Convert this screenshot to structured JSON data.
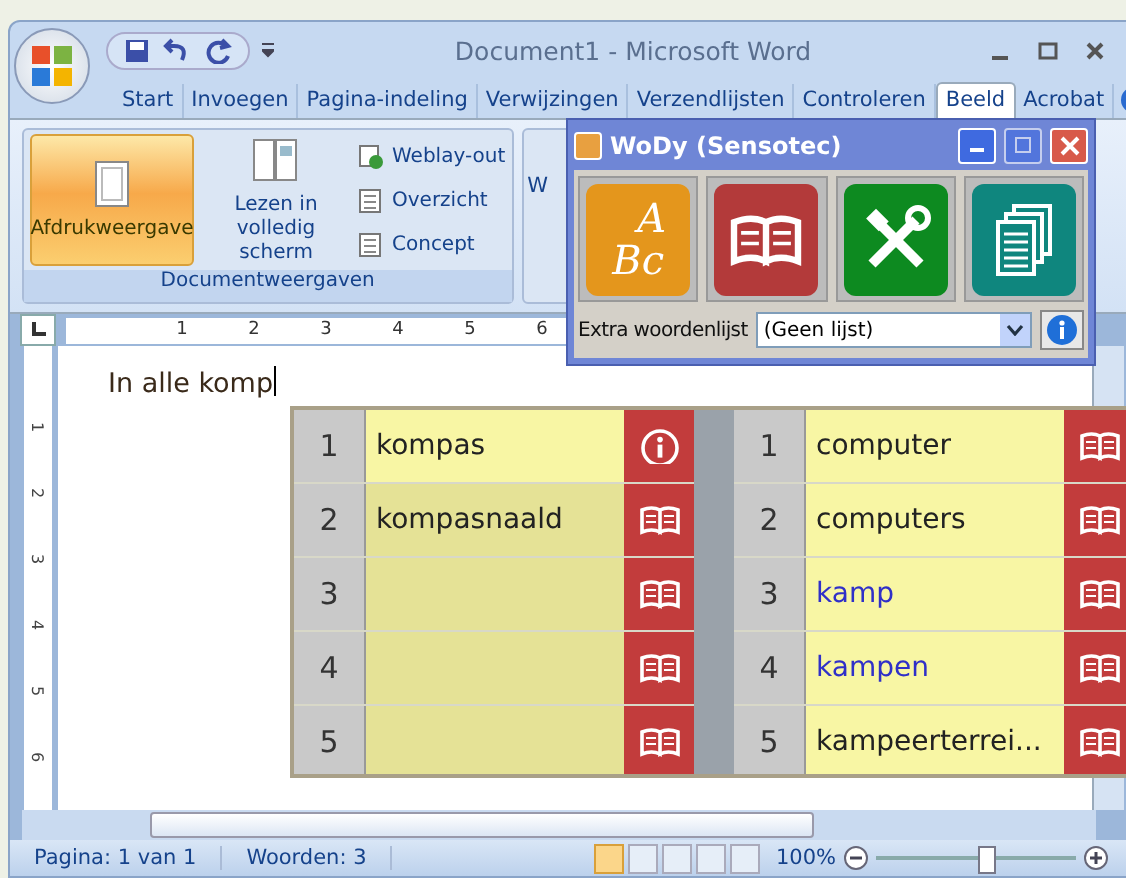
{
  "window": {
    "title": "Document1 - Microsoft Word"
  },
  "ribbon_tabs": [
    {
      "label": "Start",
      "selected": false
    },
    {
      "label": "Invoegen",
      "selected": false
    },
    {
      "label": "Pagina-indeling",
      "selected": false
    },
    {
      "label": "Verwijzingen",
      "selected": false
    },
    {
      "label": "Verzendlijsten",
      "selected": false
    },
    {
      "label": "Controleren",
      "selected": false
    },
    {
      "label": "Beeld",
      "selected": true
    },
    {
      "label": "Acrobat",
      "selected": false
    }
  ],
  "ribbon_group": {
    "label": "Documentweergaven",
    "large_buttons": [
      {
        "label": "Afdrukweergave",
        "selected": true
      },
      {
        "label": "Lezen in volledig scherm",
        "selected": false
      }
    ],
    "small_buttons": [
      "Weblay-out",
      "Overzicht",
      "Concept"
    ]
  },
  "next_group_partial": "W",
  "ruler": {
    "marks": [
      "1",
      "2",
      "3",
      "4",
      "5",
      "6"
    ]
  },
  "vertical_ruler": {
    "marks": [
      "1",
      "2",
      "3",
      "4",
      "5",
      "6"
    ]
  },
  "document": {
    "text": "In alle komp"
  },
  "wody": {
    "title": "WoDy (Sensotec)",
    "tools": [
      {
        "kind": "spelling",
        "glyph_top": "A",
        "glyph_bottom": "Bc"
      },
      {
        "kind": "dictionary"
      },
      {
        "kind": "tools"
      },
      {
        "kind": "documents"
      }
    ],
    "list_label": "Extra woordenlijst",
    "list_value": "(Geen lijst)"
  },
  "suggestions": [
    {
      "rows": [
        {
          "number": "1",
          "word": "kompas",
          "selected": true,
          "kind": "info",
          "color": "#222222"
        },
        {
          "number": "2",
          "word": "kompasnaald",
          "selected": false,
          "kind": "book",
          "color": "#222222"
        },
        {
          "number": "3",
          "selected": false,
          "kind": "book"
        },
        {
          "number": "4",
          "selected": false,
          "kind": "book"
        },
        {
          "number": "5",
          "selected": false,
          "kind": "book"
        }
      ]
    },
    {
      "rows": [
        {
          "number": "1",
          "word": "computer",
          "selected": true,
          "kind": "book",
          "color": "#222222"
        },
        {
          "number": "2",
          "word": "computers",
          "selected": true,
          "kind": "book",
          "color": "#222222"
        },
        {
          "number": "3",
          "word": "kamp",
          "selected": true,
          "kind": "book",
          "color": "#3030c8"
        },
        {
          "number": "4",
          "word": "kampen",
          "selected": true,
          "kind": "book",
          "color": "#3030c8"
        },
        {
          "number": "5",
          "word": "kampeerterrei...",
          "selected": true,
          "kind": "book",
          "color": "#222222"
        }
      ]
    }
  ],
  "status_bar": {
    "page": "Pagina: 1 van 1",
    "words": "Woorden: 3",
    "zoom": "100%",
    "zoom_slider": {
      "level": 0.55
    }
  }
}
